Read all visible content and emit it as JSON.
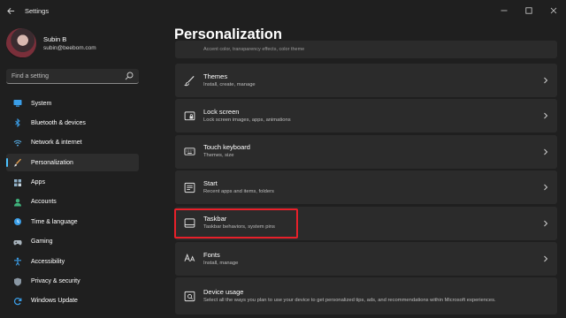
{
  "titlebar": {
    "back_icon": "back-arrow-icon",
    "title": "Settings",
    "controls": [
      "minimize-icon",
      "maximize-icon",
      "close-icon"
    ]
  },
  "profile": {
    "name": "Subin B",
    "email": "subin@beebom.com"
  },
  "search": {
    "placeholder": "Find a setting"
  },
  "nav": {
    "items": [
      {
        "label": "System",
        "icon": "monitor-icon",
        "active": false
      },
      {
        "label": "Bluetooth & devices",
        "icon": "bluetooth-icon",
        "active": false
      },
      {
        "label": "Network & internet",
        "icon": "wifi-icon",
        "active": false
      },
      {
        "label": "Personalization",
        "icon": "brush-icon",
        "active": true
      },
      {
        "label": "Apps",
        "icon": "apps-icon",
        "active": false
      },
      {
        "label": "Accounts",
        "icon": "person-icon",
        "active": false
      },
      {
        "label": "Time & language",
        "icon": "globe-clock-icon",
        "active": false
      },
      {
        "label": "Gaming",
        "icon": "gamepad-icon",
        "active": false
      },
      {
        "label": "Accessibility",
        "icon": "accessibility-icon",
        "active": false
      },
      {
        "label": "Privacy & security",
        "icon": "shield-icon",
        "active": false
      },
      {
        "label": "Windows Update",
        "icon": "update-icon",
        "active": false
      }
    ]
  },
  "main": {
    "title": "Personalization",
    "partial_card_text": "Accent color, transparency effects, color theme",
    "cards": [
      {
        "title": "Themes",
        "subtitle": "Install, create, manage",
        "icon": "brush-icon"
      },
      {
        "title": "Lock screen",
        "subtitle": "Lock screen images, apps, animations",
        "icon": "lock-screen-icon"
      },
      {
        "title": "Touch keyboard",
        "subtitle": "Themes, size",
        "icon": "keyboard-icon"
      },
      {
        "title": "Start",
        "subtitle": "Recent apps and items, folders",
        "icon": "start-icon"
      },
      {
        "title": "Taskbar",
        "subtitle": "Taskbar behaviors, system pins",
        "icon": "taskbar-icon"
      },
      {
        "title": "Fonts",
        "subtitle": "Install, manage",
        "icon": "fonts-icon"
      },
      {
        "title": "Device usage",
        "subtitle": "Select all the ways you plan to use your device to get personalized tips, ads, and recommendations within Microsoft experiences.",
        "icon": "device-usage-icon"
      }
    ]
  },
  "colors": {
    "background": "#1f1f1f",
    "card": "#2b2b2b",
    "accent": "#4cc2ff",
    "highlight": "#e8202a"
  }
}
